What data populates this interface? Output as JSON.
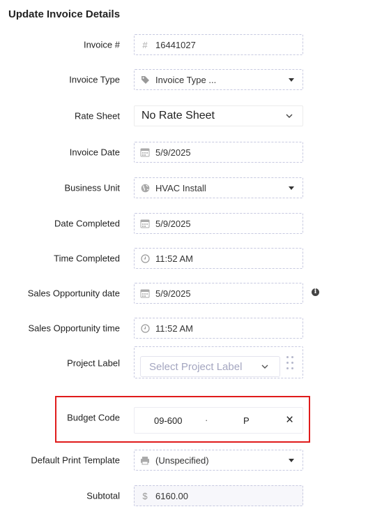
{
  "title": "Update Invoice Details",
  "fields": {
    "invoice_number": {
      "label": "Invoice #",
      "icon": "hash-icon",
      "value": "16441027"
    },
    "invoice_type": {
      "label": "Invoice Type",
      "icon": "tag-icon",
      "value": "Invoice Type ..."
    },
    "rate_sheet": {
      "label": "Rate Sheet",
      "value": "No Rate Sheet"
    },
    "invoice_date": {
      "label": "Invoice Date",
      "icon": "calendar-icon",
      "value": "5/9/2025"
    },
    "business_unit": {
      "label": "Business Unit",
      "icon": "globe-icon",
      "value": "HVAC Install"
    },
    "date_completed": {
      "label": "Date Completed",
      "icon": "calendar-icon",
      "value": "5/9/2025"
    },
    "time_completed": {
      "label": "Time Completed",
      "icon": "clock-icon",
      "value": "11:52 AM"
    },
    "sales_opportunity_date": {
      "label": "Sales Opportunity date",
      "icon": "calendar-icon",
      "value": "5/9/2025",
      "info_icon": "info-icon"
    },
    "sales_opportunity_time": {
      "label": "Sales Opportunity time",
      "icon": "clock-icon",
      "value": "11:52 AM"
    },
    "project_label": {
      "label": "Project Label",
      "placeholder": "Select Project Label"
    },
    "budget_code": {
      "label": "Budget Code",
      "part1": "09-600",
      "separator": "·",
      "part2": "P",
      "clear": "×"
    },
    "default_print_template": {
      "label": "Default Print Template",
      "icon": "printer-icon",
      "value": "(Unspecified)"
    },
    "subtotal": {
      "label": "Subtotal",
      "icon": "dollar-icon",
      "value": "6160.00"
    }
  },
  "colors": {
    "highlight": "#e01b1b",
    "border": "#c7c9e0",
    "placeholder": "#a4a6c0"
  }
}
